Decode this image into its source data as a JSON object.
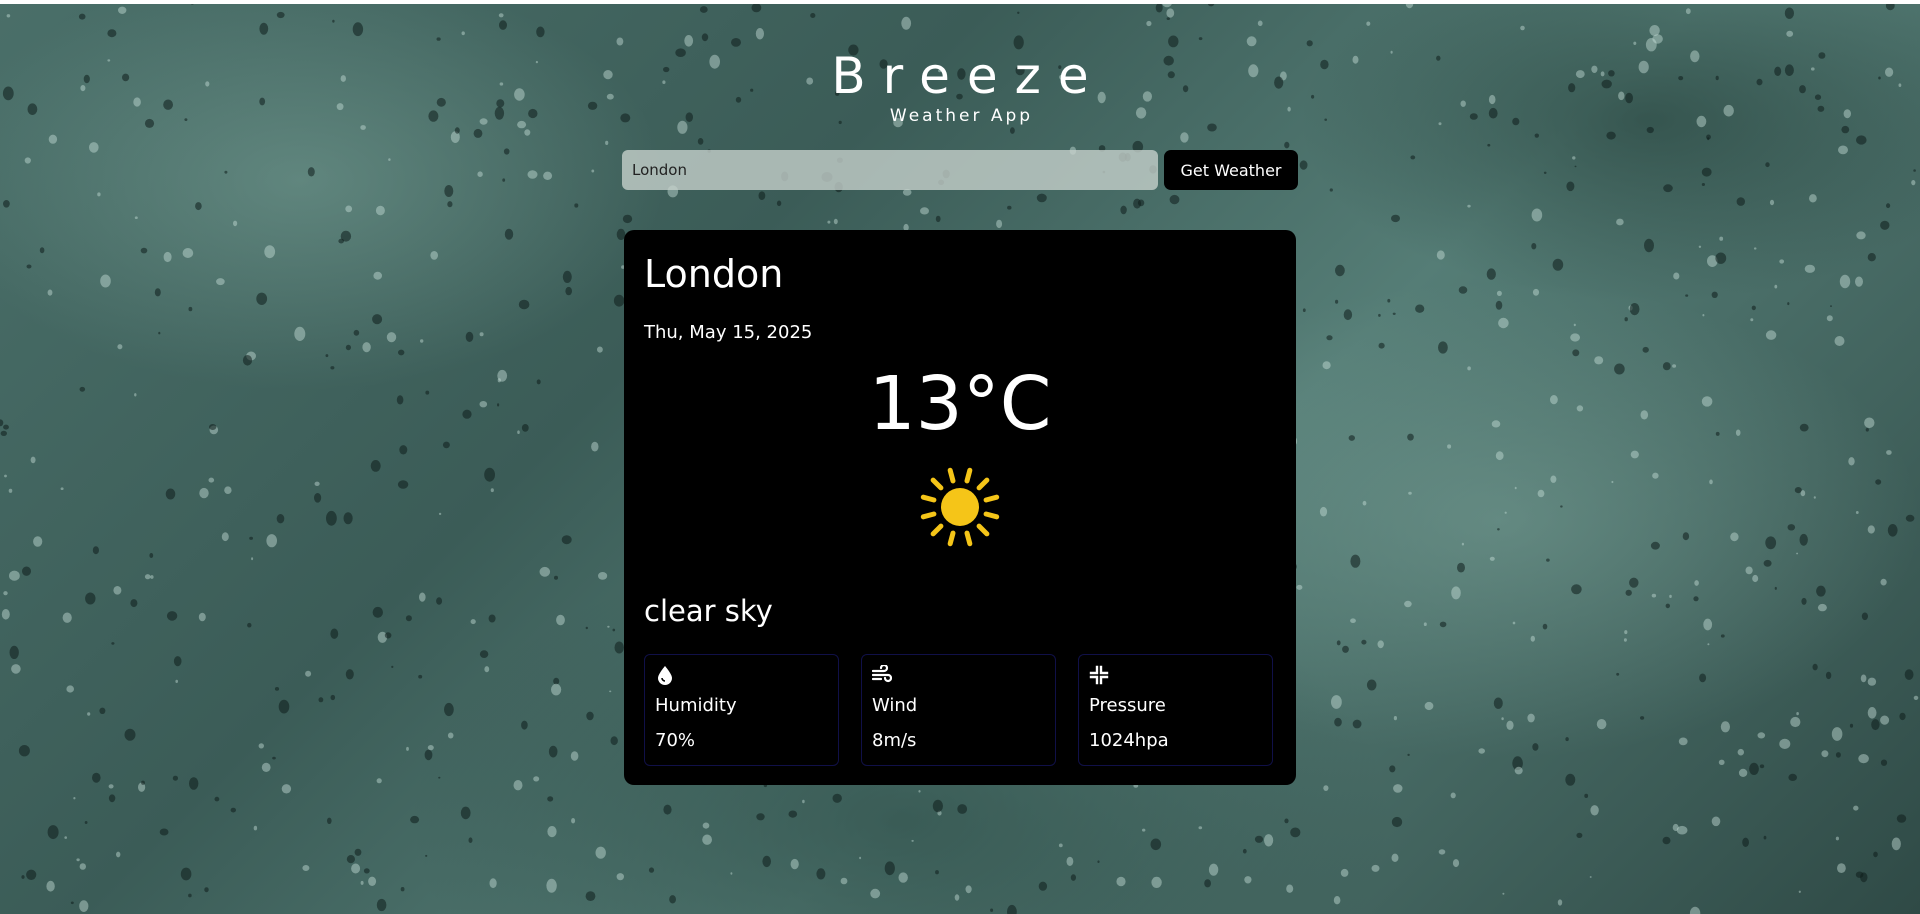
{
  "header": {
    "title": "Breeze",
    "subtitle": "Weather App"
  },
  "search": {
    "value": "London",
    "button_label": "Get Weather"
  },
  "weather": {
    "city": "London",
    "date": "Thu, May 15, 2025",
    "temperature": "13°C",
    "condition_icon": "sun-icon",
    "description": "clear sky",
    "stats": [
      {
        "icon": "droplet-icon",
        "label": "Humidity",
        "value": "70%"
      },
      {
        "icon": "wind-icon",
        "label": "Wind",
        "value": "8m/s"
      },
      {
        "icon": "compress-icon",
        "label": "Pressure",
        "value": "1024hpa"
      }
    ]
  },
  "colors": {
    "card_bg": "#000000",
    "sun": "#f5c518",
    "stat_border": "#101048"
  }
}
